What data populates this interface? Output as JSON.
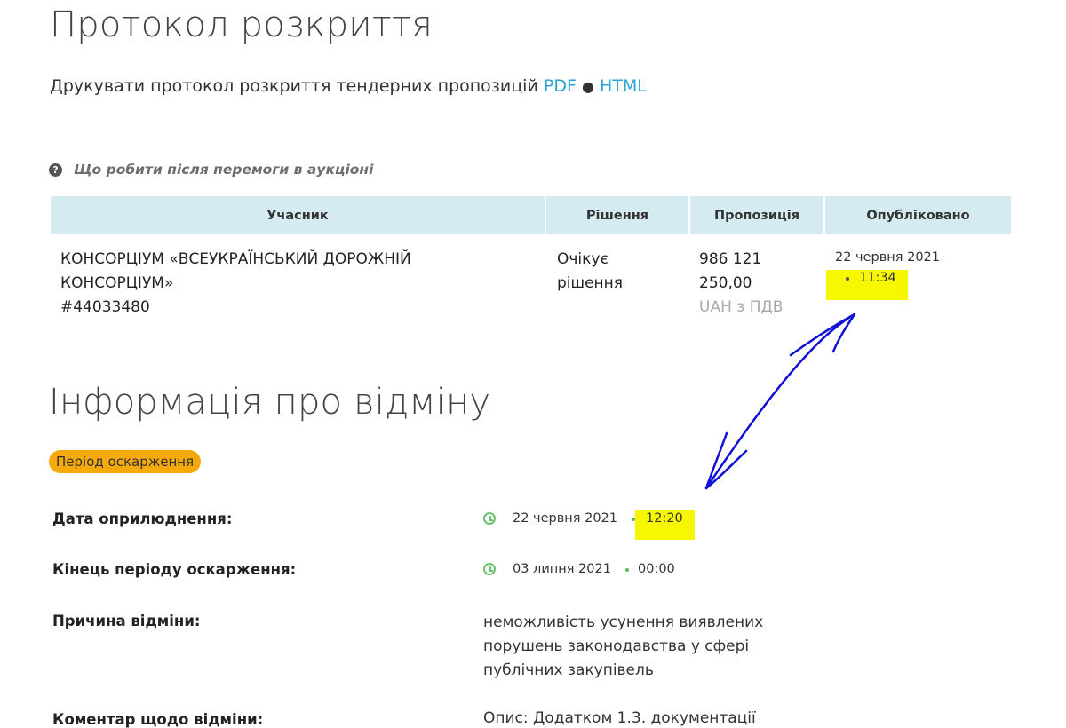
{
  "page_title": "Протокол розкриття",
  "print": {
    "text": "Друкувати протокол розкриття тендерних пропозицій",
    "pdf_label": "PDF",
    "separator": "●",
    "html_label": "HTML"
  },
  "help_link": {
    "icon": "question-circle-icon",
    "text": "Що робити після перемоги в аукціоні"
  },
  "table": {
    "headers": [
      "Учасник",
      "Рішення",
      "Пропозиція",
      "Опубліковано"
    ],
    "row": {
      "participant_line1": "КОНСОРЦІУМ «ВСЕУКРАЇНСЬКИЙ ДОРОЖНІЙ",
      "participant_line2": "КОНСОРЦІУМ»",
      "participant_id": "#44033480",
      "decision_line1": "Очікує",
      "decision_line2": "рішення",
      "amount_line1": "986 121",
      "amount_line2": "250,00",
      "currency": "UAH з ПДВ",
      "published_date": "22 червня 2021",
      "published_time": "11:34"
    }
  },
  "cancellation": {
    "title": "Інформація про відміну",
    "status_badge": "Період оскарження",
    "status_color": "#f5a90b",
    "publish_label": "Дата оприлюднення:",
    "publish_date": "22 червня 2021",
    "publish_time": "12:20",
    "end_label": "Кінець періоду оскарження:",
    "end_date": "03 липня 2021",
    "end_time": "00:00",
    "reason_label": "Причина відміни:",
    "reason_text": "неможливість усунення виявлених порушень законодавства у сфері публічних закупівель",
    "comment_label": "Коментар щодо відміни:",
    "comment_text": "Опис: Додатком 1.3. документації"
  },
  "annotation": {
    "highlight_color": "#f6f700",
    "arrow_color": "#1010d8"
  }
}
